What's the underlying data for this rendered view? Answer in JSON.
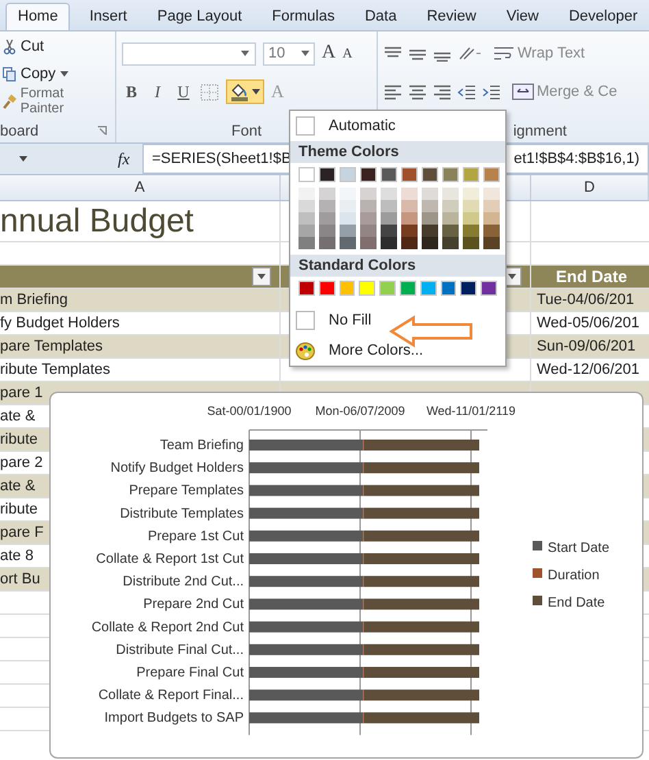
{
  "tabs": [
    {
      "label": "Home",
      "selected": true
    },
    {
      "label": "Insert",
      "selected": false
    },
    {
      "label": "Page Layout",
      "selected": false
    },
    {
      "label": "Formulas",
      "selected": false
    },
    {
      "label": "Data",
      "selected": false
    },
    {
      "label": "Review",
      "selected": false
    },
    {
      "label": "View",
      "selected": false
    },
    {
      "label": "Developer",
      "selected": false
    }
  ],
  "clipboard": {
    "cut": "Cut",
    "copy": "Copy",
    "format_painter": "Format Painter",
    "group_label": "board"
  },
  "font": {
    "size": "10",
    "grow": "A",
    "shrink": "A",
    "bold": "B",
    "italic": "I",
    "underline": "U",
    "font_color": "A",
    "group_label": "Font"
  },
  "alignment": {
    "wrap_text": "Wrap Text",
    "merge": "Merge & Ce",
    "group_label": "ignment"
  },
  "formula_bar": {
    "fx": "fx",
    "formula_left": "=SERIES(Sheet1!$B",
    "formula_right": "et1!$B$4:$B$16,1)"
  },
  "sheet": {
    "column_a": "A",
    "column_d": "D",
    "title": "nnual Budget",
    "header_d": "End Date",
    "rows": [
      {
        "a": "m Briefing",
        "d": "Tue-04/06/201"
      },
      {
        "a": "fy Budget Holders",
        "d": "Wed-05/06/201"
      },
      {
        "a": "pare Templates",
        "d": "Sun-09/06/201"
      },
      {
        "a": "ribute Templates",
        "d": "Wed-12/06/201"
      },
      {
        "a": "pare 1"
      },
      {
        "a": "ate &"
      },
      {
        "a": "ribute"
      },
      {
        "a": "pare 2"
      },
      {
        "a": "ate &"
      },
      {
        "a": "ribute"
      },
      {
        "a": "pare F"
      },
      {
        "a": "ate 8"
      },
      {
        "a": "ort Bu"
      }
    ]
  },
  "fill_menu": {
    "automatic": "Automatic",
    "theme_title": "Theme Colors",
    "theme_colors": [
      {
        "color": "#ffffff"
      },
      {
        "color": "#2b2226"
      },
      {
        "color": "#c5d4de"
      },
      {
        "color": "#3b2220"
      },
      {
        "color": "#5a5a5a"
      },
      {
        "color": "#a0502a"
      },
      {
        "color": "#5e4e3a"
      },
      {
        "color": "#8a8258"
      },
      {
        "color": "#b3a540"
      },
      {
        "color": "#b7834a"
      }
    ],
    "standard_title": "Standard Colors",
    "standard_colors": [
      {
        "color": "#c00000"
      },
      {
        "color": "#ff0000"
      },
      {
        "color": "#ffc000"
      },
      {
        "color": "#ffff00"
      },
      {
        "color": "#92d050"
      },
      {
        "color": "#00b050"
      },
      {
        "color": "#00b0f0"
      },
      {
        "color": "#0070c0"
      },
      {
        "color": "#002060"
      },
      {
        "color": "#7030a0"
      }
    ],
    "no_fill": "No Fill",
    "more_colors": "More Colors..."
  },
  "chart": {
    "tick_labels": [
      "Sat-00/01/1900",
      "Mon-06/07/2009",
      "Wed-11/01/2119"
    ],
    "tasks": [
      "Team Briefing",
      "Notify Budget Holders",
      "Prepare Templates",
      "Distribute Templates",
      "Prepare 1st Cut",
      "Collate & Report 1st Cut",
      "Distribute 2nd Cut...",
      "Prepare 2nd Cut",
      "Collate & Report 2nd Cut",
      "Distribute Final Cut...",
      "Prepare Final Cut",
      "Collate & Report Final...",
      "Import Budgets to SAP"
    ],
    "legend": [
      {
        "name": "Start Date",
        "color": "#595959"
      },
      {
        "name": "Duration",
        "color": "#a0522d"
      },
      {
        "name": "End Date",
        "color": "#5e4e3a"
      }
    ]
  }
}
